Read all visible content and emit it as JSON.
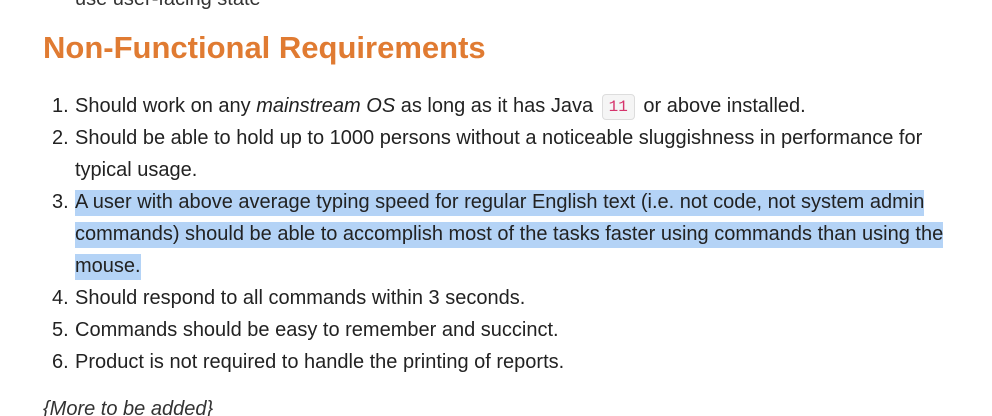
{
  "top_fragment": "use user-facing state",
  "heading": "Non-Functional Requirements",
  "requirements": [
    {
      "num": "1.",
      "pre": "Should work on any ",
      "em": "mainstream OS",
      "mid": " as long as it has Java ",
      "code": "11",
      "post": " or above installed."
    },
    {
      "num": "2.",
      "text": "Should be able to hold up to 1000 persons without a noticeable sluggishness in performance for typical usage."
    },
    {
      "num": "3.",
      "text": "A user with above average typing speed for regular English text (i.e. not code, not system admin commands) should be able to accomplish most of the tasks faster using commands than using the mouse."
    },
    {
      "num": "4.",
      "text": "Should respond to all commands within 3 seconds."
    },
    {
      "num": "5.",
      "text": "Commands should be easy to remember and succinct."
    },
    {
      "num": "6.",
      "text": "Product is not required to handle the printing of reports."
    }
  ],
  "more_note": "{More to be added}",
  "colors": {
    "heading": "#e07b32",
    "selection": "#b4d3f6",
    "code_text": "#d6336c"
  }
}
